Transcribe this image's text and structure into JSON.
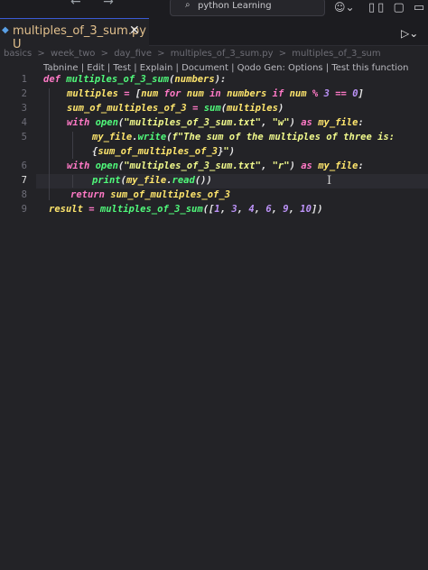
{
  "titlebar": {
    "search_text": "python Learning",
    "layout_icons": "▯▯ ▢ ▭"
  },
  "tab": {
    "filename": "multiples_of_3_sum.py",
    "status": "U",
    "close": "✕"
  },
  "run_label": "▷⌄",
  "breadcrumb": [
    "basics",
    ">",
    "week_two",
    ">",
    "day_five",
    ">",
    "multiples_of_3_sum.py",
    ">",
    "multiples_of_3_sum"
  ],
  "codelens": "Tabnine | Edit | Test | Explain | Document | Qodo Gen: Options | Test this function",
  "line_numbers": [
    "1",
    "2",
    "3",
    "4",
    "5",
    "",
    "6",
    "7",
    "8",
    "9"
  ],
  "code": {
    "l1": {
      "kw": "def ",
      "fn": "multiples_of_3_sum",
      "p1": "(",
      "var": "numbers",
      "p2": "):"
    },
    "l2": {
      "var1": "multiples",
      "op1": " = ",
      "p1": "[",
      "var2": "num ",
      "kw1": "for ",
      "var3": "num ",
      "kw2": "in ",
      "var4": "numbers ",
      "kw3": "if ",
      "var5": "num ",
      "op2": "% ",
      "num1": "3 ",
      "op3": "== ",
      "num2": "0",
      "p2": "]"
    },
    "l3": {
      "var1": "sum_of_multiples_of_3",
      "op1": " = ",
      "fn": "sum",
      "p1": "(",
      "var2": "multiples",
      "p2": ")"
    },
    "l4": {
      "kw1": "with ",
      "fn": "open",
      "p1": "(",
      "str1": "\"multiples_of_3_sum.txt\"",
      "p2": ", ",
      "str2": "\"w\"",
      "p3": ") ",
      "kw2": "as ",
      "var": "my_file",
      "p4": ":"
    },
    "l5": {
      "var": "my_file",
      "p1": ".",
      "fn": "write",
      "p2": "(",
      "fs": "f\"The sum of the multiples of three is:"
    },
    "l5b": {
      "p1": "{",
      "var": "sum_of_multiples_of_3",
      "p2": "}",
      "fs": "\"",
      "p3": ")"
    },
    "l6": {
      "kw1": "with ",
      "fn": "open",
      "p1": "(",
      "str1": "\"multiples_of_3_sum.txt\"",
      "p2": ", ",
      "str2": "\"r\"",
      "p3": ") ",
      "kw2": "as ",
      "var": "my_file",
      "p4": ":"
    },
    "l7": {
      "fn1": "print",
      "p1": "(",
      "var": "my_file",
      "p2": ".",
      "fn2": "read",
      "p3": "())"
    },
    "l8": {
      "kw": "return ",
      "var": "sum_of_multiples_of_3"
    },
    "l9": {
      "var": "result",
      "op": " = ",
      "fn": "multiples_of_3_sum",
      "p1": "([",
      "n1": "1",
      "c1": ", ",
      "n2": "3",
      "c2": ", ",
      "n3": "4",
      "c3": ", ",
      "n4": "6",
      "c4": ", ",
      "n5": "9",
      "c5": ", ",
      "n6": "10",
      "p2": "])"
    }
  },
  "colors": {
    "background": "#232327",
    "keyword": "#ff79c6",
    "function": "#50fa7b",
    "variable": "#ffe66d",
    "string": "#f1fa8c",
    "number": "#bd93f9"
  }
}
